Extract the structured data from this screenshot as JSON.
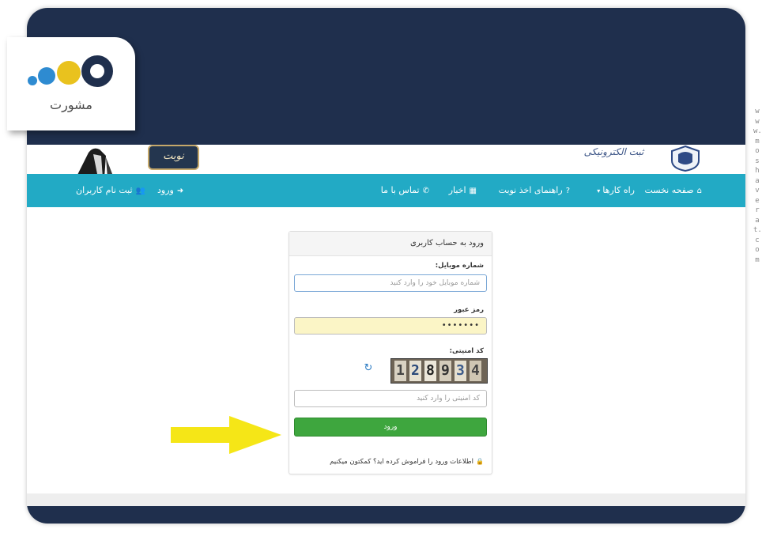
{
  "brand": {
    "logo_text": "مشورت",
    "logo_colors": [
      "#2e8bd1",
      "#e9c21e",
      "#1f2f4d"
    ]
  },
  "watermark_url": "www.moshaverat.com",
  "header": {
    "left_logo_text": "نوبت",
    "site_title": "ثبت الکترونیکی"
  },
  "nav": {
    "home": "صفحه نخست",
    "guides": "راه کارها",
    "appointment_help": "راهنمای اخذ نوبت",
    "news": "اخبار",
    "contact": "تماس با ما",
    "login": "ورود",
    "register": "ثبت نام کاربران"
  },
  "login": {
    "title": "ورود به حساب کاربری",
    "mobile_label": "شماره موبایل:",
    "mobile_placeholder": "شماره موبایل خود را وارد کنید",
    "password_label": "رمز عبور",
    "password_value": "•••••••",
    "captcha_label": "کد امنیتی:",
    "captcha_digits": [
      "1",
      "2",
      "8",
      "9",
      "3",
      "4"
    ],
    "captcha_input_placeholder": "کد امنیتی را وارد کنید",
    "submit_label": "ورود",
    "forgot_text": "اطلاعات ورود را فراموش کرده اید؟ کمکتون میکنیم"
  },
  "colors": {
    "navbar": "#22aac5",
    "dark_band": "#1f2f4d",
    "login_button": "#3ea63e",
    "password_bg": "#fbf5c6",
    "arrow": "#f5e617"
  }
}
